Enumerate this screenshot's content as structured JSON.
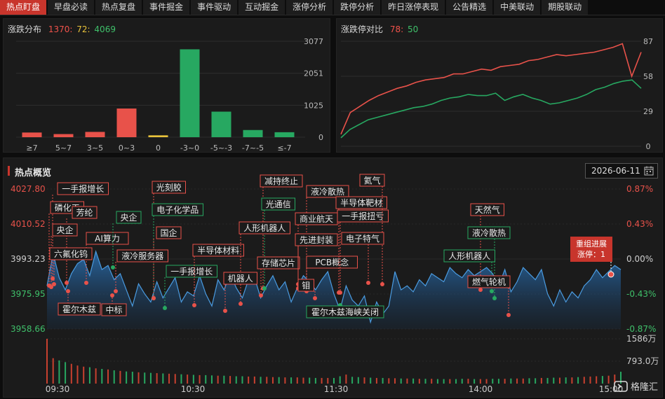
{
  "nav": {
    "tabs": [
      "热点盯盘",
      "早盘必读",
      "热点复盘",
      "事件掘金",
      "事件驱动",
      "互动掘金",
      "涨停分析",
      "跌停分析",
      "昨日涨停表现",
      "公告精选",
      "中美联动",
      "期股联动"
    ],
    "active": 0
  },
  "dist": {
    "title": "涨跌分布",
    "up": "1370",
    "sep1": ":",
    "flat": "72",
    "sep2": ":",
    "down": "4069"
  },
  "ratio": {
    "title": "涨跌停对比",
    "up": "78",
    "sep": ":",
    "down": "50"
  },
  "hot": {
    "title": "热点概览",
    "date": "2026-06-11"
  },
  "logo": {
    "text": "格隆汇"
  },
  "colors": {
    "up": "#e8524a",
    "down": "#27a861",
    "flat": "#e8c23a",
    "accent": "#c8352c"
  },
  "chart_data": [
    {
      "type": "bar",
      "title": "涨跌分布",
      "categories": [
        "≥7",
        "5~7",
        "3~5",
        "0~3",
        "0",
        "-3~0",
        "-5~-3",
        "-7~-5",
        "≤-7"
      ],
      "values": [
        150,
        100,
        170,
        920,
        60,
        2820,
        820,
        230,
        160
      ],
      "colors": [
        "up",
        "up",
        "up",
        "up",
        "flat",
        "down",
        "down",
        "down",
        "down"
      ],
      "yticks": [
        "3077",
        "2051",
        "1025",
        "0"
      ],
      "ylim": [
        0,
        3077
      ]
    },
    {
      "type": "line",
      "title": "涨跌停对比",
      "yticks": [
        "87",
        "58",
        "29",
        "0"
      ],
      "ylim": [
        0,
        87
      ],
      "series": [
        {
          "color": "up",
          "values": [
            10,
            28,
            33,
            38,
            42,
            45,
            48,
            50,
            53,
            55,
            56,
            57,
            60,
            60,
            62,
            64,
            63,
            66,
            67,
            68,
            71,
            72,
            74,
            76,
            75,
            76,
            77,
            78,
            80,
            82,
            85,
            58,
            78
          ]
        },
        {
          "color": "down",
          "values": [
            7,
            14,
            18,
            22,
            24,
            26,
            28,
            30,
            32,
            33,
            35,
            38,
            40,
            41,
            43,
            42,
            42,
            44,
            38,
            41,
            43,
            40,
            38,
            35,
            36,
            38,
            40,
            43,
            47,
            49,
            52,
            54,
            55,
            48
          ]
        }
      ]
    },
    {
      "type": "area",
      "title": "热点概览",
      "ylim": [
        3958.66,
        4027.8
      ],
      "yticks_left": [
        "4027.80",
        "4010.52",
        "3993.23",
        "3975.95",
        "3958.66"
      ],
      "yticks_right": [
        "0.87%",
        "0.43%",
        "0.00%",
        "-0.43%",
        "-0.87%"
      ],
      "xticks": [
        "09:30",
        "10:30",
        "11:30",
        "14:00",
        "15:00"
      ],
      "volume_ticks": [
        "1586万",
        "793.0万"
      ],
      "price": [
        3980,
        3996,
        3984,
        3978,
        3986,
        3991,
        3993,
        3985,
        3997,
        3988,
        3990,
        3983,
        3986,
        3978,
        3970,
        3981,
        3976,
        3972,
        3982,
        3974,
        3979,
        3984,
        3972,
        3977,
        3975,
        3985,
        3976,
        3970,
        3983,
        3978,
        3986,
        3979,
        3974,
        3983,
        3984,
        3974,
        3980,
        3985,
        3978,
        3982,
        3972,
        3979,
        3985,
        3982,
        3978,
        3983,
        3987,
        3976,
        3968,
        3980,
        3973,
        3970,
        3975,
        3962,
        3972,
        3966,
        3970,
        3987,
        3978,
        3980,
        3977,
        3983,
        3980,
        3986,
        3984,
        3982,
        3989,
        3986,
        3984,
        3988,
        3985,
        3987,
        3989,
        3986,
        3980,
        3988,
        3977,
        3982,
        3989,
        3986,
        3983,
        3988,
        3976,
        3970,
        3978,
        3972,
        3977,
        3974,
        3980,
        3983,
        3988,
        3984,
        3987,
        3990,
        3988
      ],
      "volume": [
        1586,
        900,
        820,
        760,
        700,
        640,
        600,
        580,
        540,
        520,
        500,
        470,
        450,
        430,
        420,
        400,
        390,
        380,
        370,
        360,
        350,
        340,
        330,
        320,
        310,
        300,
        300,
        290,
        280,
        280,
        270,
        260,
        260,
        250,
        250,
        240,
        240,
        230,
        230,
        220,
        220,
        220,
        210,
        210,
        200,
        200,
        200,
        200,
        260,
        320,
        240,
        230,
        220,
        210,
        200,
        200,
        190,
        190,
        180,
        180,
        180,
        170,
        170,
        170,
        160,
        160,
        160,
        160,
        170,
        170,
        160,
        160,
        160,
        170,
        170,
        170,
        180,
        180,
        180,
        190,
        190,
        200,
        200,
        210,
        210,
        220,
        220,
        230,
        240,
        250,
        260,
        270,
        280,
        320,
        420
      ],
      "events": [
        {
          "text": "一手报增长",
          "color": "red"
        },
        {
          "text": "磷化工",
          "color": "red"
        },
        {
          "text": "芳纶",
          "color": "red"
        },
        {
          "text": "央企",
          "color": "red"
        },
        {
          "text": "AI算力",
          "color": "red"
        },
        {
          "text": "六氟化钨",
          "color": "red"
        },
        {
          "text": "央企",
          "color": "green"
        },
        {
          "text": "霍尔木兹",
          "color": "red"
        },
        {
          "text": "中标",
          "color": "red"
        },
        {
          "text": "光刻胶",
          "color": "red"
        },
        {
          "text": "电子化学品",
          "color": "green"
        },
        {
          "text": "国企",
          "color": "red"
        },
        {
          "text": "液冷服务器",
          "color": "red"
        },
        {
          "text": "一手报增长",
          "color": "green"
        },
        {
          "text": "半导体材料",
          "color": "red"
        },
        {
          "text": "减持终止",
          "color": "red"
        },
        {
          "text": "光通信",
          "color": "green"
        },
        {
          "text": "人形机器人",
          "color": "red"
        },
        {
          "text": "机器人",
          "color": "red"
        },
        {
          "text": "存储芯片",
          "color": "red"
        },
        {
          "text": "液冷散热",
          "color": "red"
        },
        {
          "text": "商业航天",
          "color": "red"
        },
        {
          "text": "先进封装",
          "color": "red"
        },
        {
          "text": "PCB概念",
          "color": "red"
        },
        {
          "text": "钼",
          "color": "red"
        },
        {
          "text": "半导体靶材",
          "color": "red"
        },
        {
          "text": "一手报扭亏",
          "color": "red"
        },
        {
          "text": "氦气",
          "color": "red"
        },
        {
          "text": "电子特气",
          "color": "red"
        },
        {
          "text": "霍尔木兹海峡关闭",
          "color": "green"
        },
        {
          "text": "天然气",
          "color": "red"
        },
        {
          "text": "液冷散热",
          "color": "green"
        },
        {
          "text": "人形机器人",
          "color": "green"
        },
        {
          "text": "燃气轮机",
          "color": "red"
        }
      ],
      "callout": {
        "line1": "重组进展",
        "line2": "涨停：1"
      }
    }
  ]
}
